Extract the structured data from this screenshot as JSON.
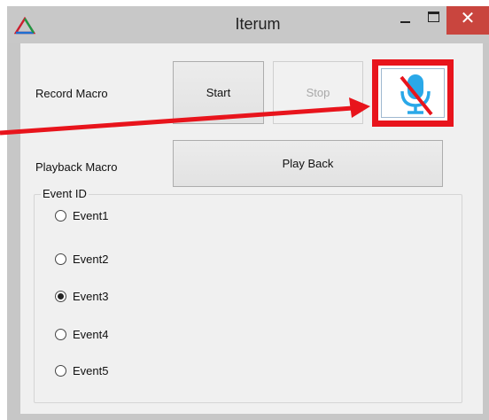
{
  "window": {
    "title": "Iterum",
    "close_glyph": "✕"
  },
  "controls": {
    "record_label": "Record Macro",
    "start_label": "Start",
    "stop_label": "Stop",
    "playback_label": "Playback Macro",
    "playback_button": "Play Back",
    "mic_icon": "microphone-muted-icon"
  },
  "events": {
    "group_title": "Event ID",
    "items": [
      {
        "label": "Event1",
        "checked": false
      },
      {
        "label": "Event2",
        "checked": false
      },
      {
        "label": "Event3",
        "checked": true
      },
      {
        "label": "Event4",
        "checked": false
      },
      {
        "label": "Event5",
        "checked": false
      }
    ]
  },
  "colors": {
    "highlight": "#e8141c",
    "mic": "#2aa8e8",
    "close": "#c9453e"
  }
}
